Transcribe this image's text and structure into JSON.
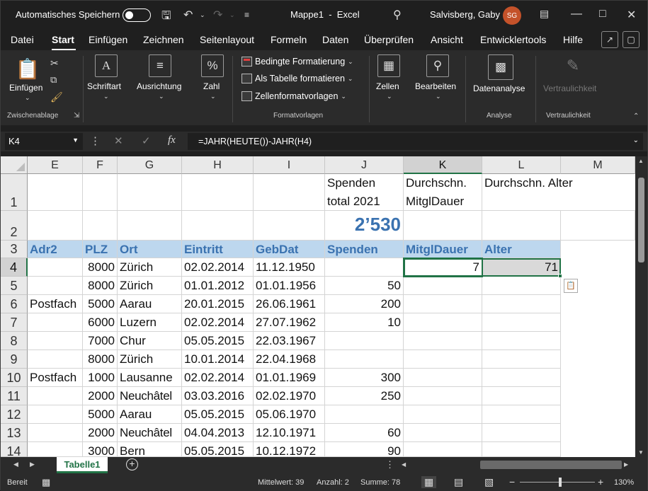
{
  "title": {
    "autosave_label": "Automatisches Speichern",
    "doc_name": "Mappe1",
    "separator": "-",
    "app_name": "Excel",
    "user_name": "Salvisberg, Gaby",
    "user_initials": "SG"
  },
  "menu": [
    "Datei",
    "Start",
    "Einfügen",
    "Zeichnen",
    "Seitenlayout",
    "Formeln",
    "Daten",
    "Überprüfen",
    "Ansicht",
    "Entwicklertools",
    "Hilfe"
  ],
  "ribbon": {
    "paste": "Einfügen",
    "font": "Schriftart",
    "align": "Ausrichtung",
    "number": "Zahl",
    "cond_format": "Bedingte Formatierung",
    "as_table": "Als Tabelle formatieren",
    "cell_styles": "Zellenformatvorlagen",
    "cells": "Zellen",
    "editing": "Bearbeiten",
    "data_analysis": "Datenanalyse",
    "sensitivity": "Vertraulichkeit",
    "groups": {
      "clipboard": "Zwischenablage",
      "styles": "Formatvorlagen",
      "analysis": "Analyse",
      "sensitivity": "Vertraulichkeit"
    }
  },
  "formula_bar": {
    "name_box": "K4",
    "fx": "fx",
    "formula": "=JAHR(HEUTE())-JAHR(H4)"
  },
  "columns": [
    "E",
    "F",
    "G",
    "H",
    "I",
    "J",
    "K",
    "L",
    "M"
  ],
  "rows": [
    "1",
    "2",
    "3",
    "4",
    "5",
    "6",
    "7",
    "8",
    "9",
    "10",
    "11",
    "12",
    "13",
    "14"
  ],
  "sheet": {
    "J1": "Spenden total 2021",
    "K1": "Durchschn. MitglDauer",
    "L1": "Durchschn. Alter",
    "J2": "2’530",
    "headers": [
      "Adr2",
      "PLZ",
      "Ort",
      "Eintritt",
      "GebDat",
      "Spenden",
      "MitglDauer",
      "Alter"
    ],
    "data": [
      [
        "",
        "8000",
        "Zürich",
        "02.02.2014",
        "11.12.1950",
        "",
        "7",
        "71"
      ],
      [
        "",
        "8000",
        "Zürich",
        "01.01.2012",
        "01.01.1956",
        "50",
        "",
        ""
      ],
      [
        "Postfach",
        "5000",
        "Aarau",
        "20.01.2015",
        "26.06.1961",
        "200",
        "",
        ""
      ],
      [
        "",
        "6000",
        "Luzern",
        "02.02.2014",
        "27.07.1962",
        "10",
        "",
        ""
      ],
      [
        "",
        "7000",
        "Chur",
        "05.05.2015",
        "22.03.1967",
        "",
        "",
        ""
      ],
      [
        "",
        "8000",
        "Zürich",
        "10.01.2014",
        "22.04.1968",
        "",
        "",
        ""
      ],
      [
        "Postfach",
        "1000",
        "Lausanne",
        "02.02.2014",
        "01.01.1969",
        "300",
        "",
        ""
      ],
      [
        "",
        "2000",
        "Neuchâtel",
        "03.03.2016",
        "02.02.1970",
        "250",
        "",
        ""
      ],
      [
        "",
        "5000",
        "Aarau",
        "05.05.2015",
        "05.06.1970",
        "",
        "",
        ""
      ],
      [
        "",
        "2000",
        "Neuchâtel",
        "04.04.2013",
        "12.10.1971",
        "60",
        "",
        ""
      ],
      [
        "",
        "3000",
        "Bern",
        "05.05.2015",
        "10.12.1972",
        "90",
        "",
        ""
      ]
    ]
  },
  "sheet_tab": "Tabelle1",
  "status": {
    "ready": "Bereit",
    "average": "Mittelwert: 39",
    "count": "Anzahl: 2",
    "sum": "Summe: 78",
    "zoom": "130%"
  }
}
